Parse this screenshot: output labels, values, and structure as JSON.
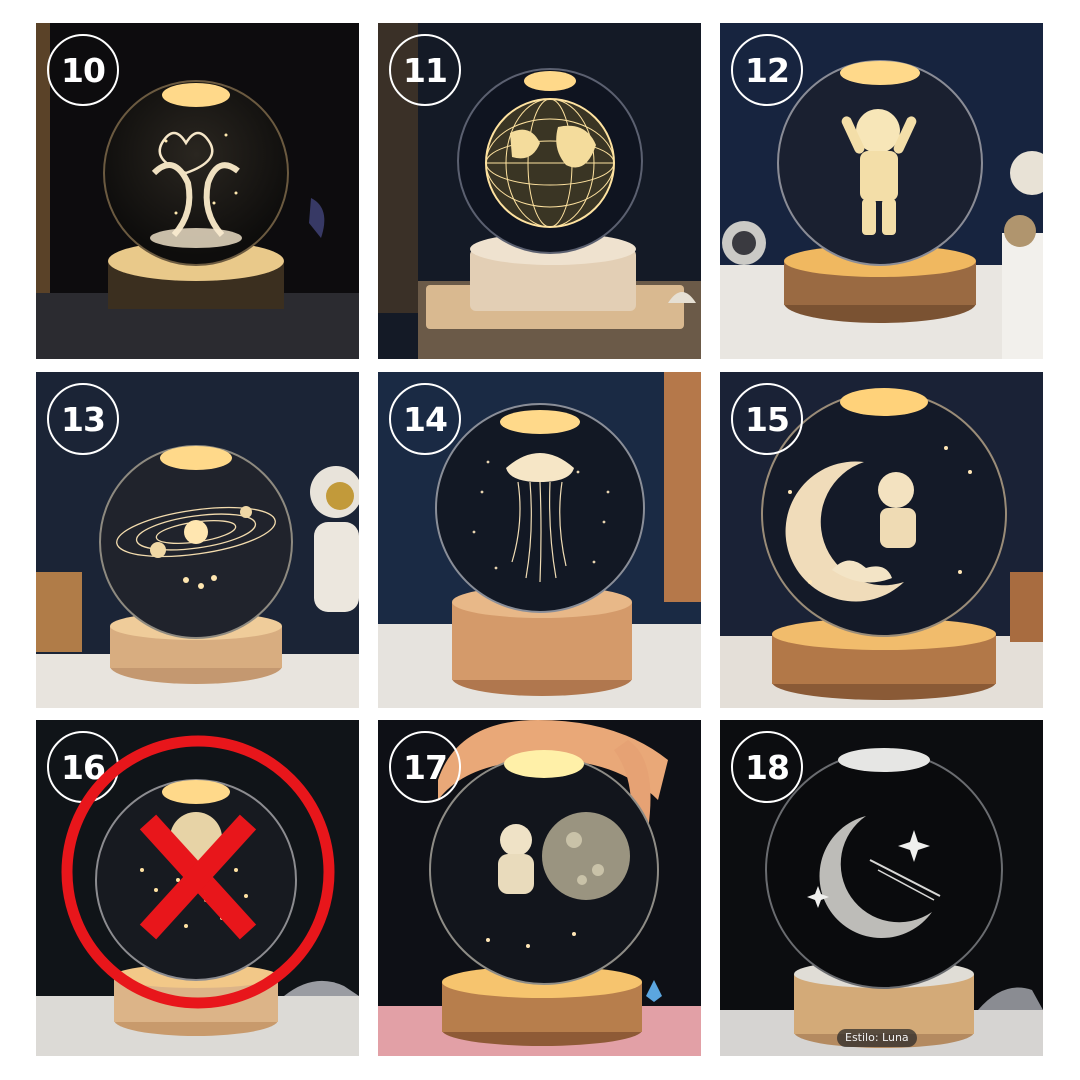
{
  "tiles": [
    {
      "number": "10",
      "design": "dolphins-heart"
    },
    {
      "number": "11",
      "design": "globe"
    },
    {
      "number": "12",
      "design": "astronaut"
    },
    {
      "number": "13",
      "design": "solar-system"
    },
    {
      "number": "14",
      "design": "jellyfish"
    },
    {
      "number": "15",
      "design": "astronaut-on-moon"
    },
    {
      "number": "16",
      "design": "planet-stars",
      "rejected": true
    },
    {
      "number": "17",
      "design": "astronaut-with-planet"
    },
    {
      "number": "18",
      "design": "crescent-moon",
      "caption": "Estilo: Luna"
    }
  ],
  "colors": {
    "glow": "#ffd98a",
    "reject_red": "#e8161b",
    "wood": "#c99769"
  },
  "icons": {
    "reject_mark": "red-circle-x-icon"
  }
}
